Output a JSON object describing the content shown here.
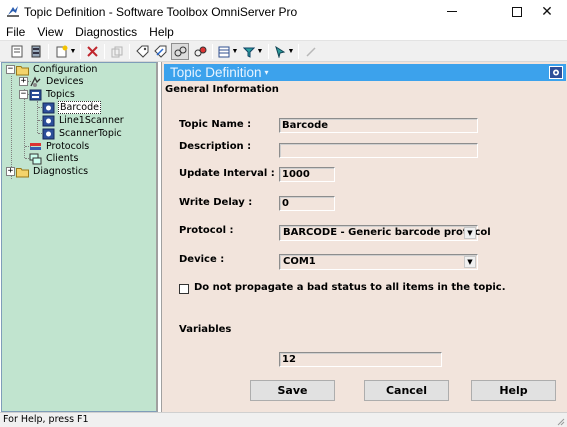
{
  "window": {
    "title": "Topic Definition - Software Toolbox OmniServer Pro",
    "minimize_glyph": "—",
    "maximize_glyph": "☐",
    "close_glyph": "✕"
  },
  "menu": {
    "items": [
      "File",
      "View",
      "Diagnostics",
      "Help"
    ]
  },
  "toolbar": {
    "icons": [
      "properties-icon",
      "server-icon",
      "new-item-icon",
      "delete-icon",
      "disabled-copy-icon",
      "tag-icon",
      "tag-edit-icon",
      "link-icon",
      "link-add-icon",
      "grid-view-icon",
      "filter-icon",
      "cursor-icon",
      "pencil-icon"
    ]
  },
  "tree": {
    "nodes": [
      {
        "label": "Configuration",
        "icon": "folder-icon"
      },
      {
        "label": "Devices",
        "icon": "devices-icon"
      },
      {
        "label": "Topics",
        "icon": "topics-icon"
      },
      {
        "label": "Barcode",
        "icon": "topic-icon",
        "selected": true
      },
      {
        "label": "Line1Scanner",
        "icon": "topic-icon"
      },
      {
        "label": "ScannerTopic",
        "icon": "topic-icon"
      },
      {
        "label": "Protocols",
        "icon": "protocols-icon"
      },
      {
        "label": "Clients",
        "icon": "clients-icon"
      },
      {
        "label": "Diagnostics",
        "icon": "folder-icon"
      }
    ],
    "expand_plus": "+",
    "expand_minus": "−"
  },
  "panel": {
    "header_title": "Topic Definition",
    "header_arrow": "▾",
    "section_title": "General Information"
  },
  "form": {
    "topic_name_label": "Topic Name :",
    "topic_name_value": "Barcode",
    "description_label": "Description :",
    "description_value": "",
    "update_interval_label": "Update Interval :",
    "update_interval_value": "1000",
    "write_delay_label": "Write Delay :",
    "write_delay_value": "0",
    "protocol_label": "Protocol :",
    "protocol_value": "BARCODE - Generic barcode protocol",
    "device_label": "Device :",
    "device_value": "COM1",
    "propagate_label": "Do not propagate a bad status to all items in the topic.",
    "propagate_checked": false,
    "variables_label": "Variables",
    "variables_value": "12"
  },
  "buttons": {
    "save": "Save",
    "cancel": "Cancel",
    "help": "Help"
  },
  "status": {
    "text": "For Help, press F1"
  },
  "colors": {
    "tree_bg": "#c1e4cf",
    "panel_bg": "#f2e4dc",
    "header_bg": "#3ca2ec"
  }
}
